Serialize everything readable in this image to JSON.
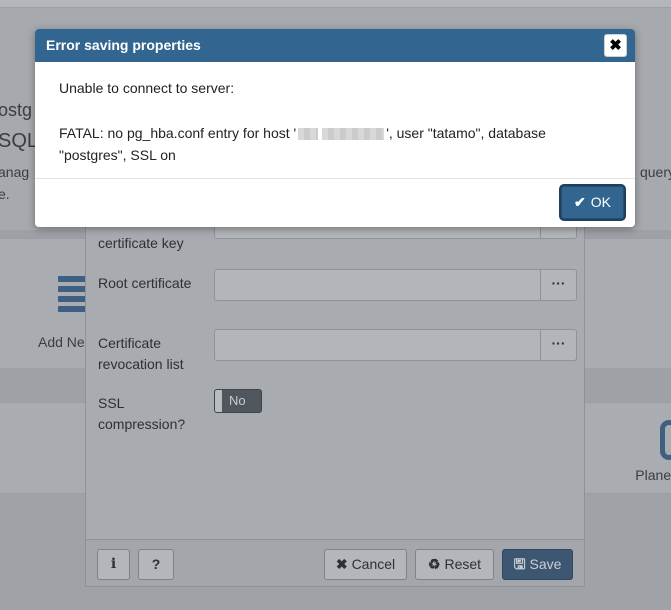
{
  "background": {
    "frag_postg": "ostg",
    "frag_sql": "SQL",
    "frag_manage": "anag",
    "frag_e": "e.",
    "frag_query": "query",
    "add_new": "Add Ne",
    "planet": "Planet"
  },
  "props_dialog": {
    "cert_key_label": "certificate key",
    "root_cert_label": "Root certificate",
    "crl_label": "Certificate revocation list",
    "ssl_compression_label": "SSL compression?",
    "dots": "···",
    "toggle_value": "No",
    "footer": {
      "info_icon": "i",
      "help_icon": "?",
      "cancel_label": "Cancel",
      "reset_label": "Reset",
      "save_label": "Save"
    }
  },
  "alert": {
    "title": "Error saving properties",
    "close_glyph": "✖",
    "message_line1": "Unable to connect to server:",
    "message_part1": "FATAL: no pg_hba.conf entry for host '",
    "message_part2": "', user \"tatamo\", database",
    "message_part3": "\"postgres\", SSL on",
    "ok_label": "OK"
  },
  "colors": {
    "header_blue": "#326690",
    "overlay": "#a9acb1"
  }
}
